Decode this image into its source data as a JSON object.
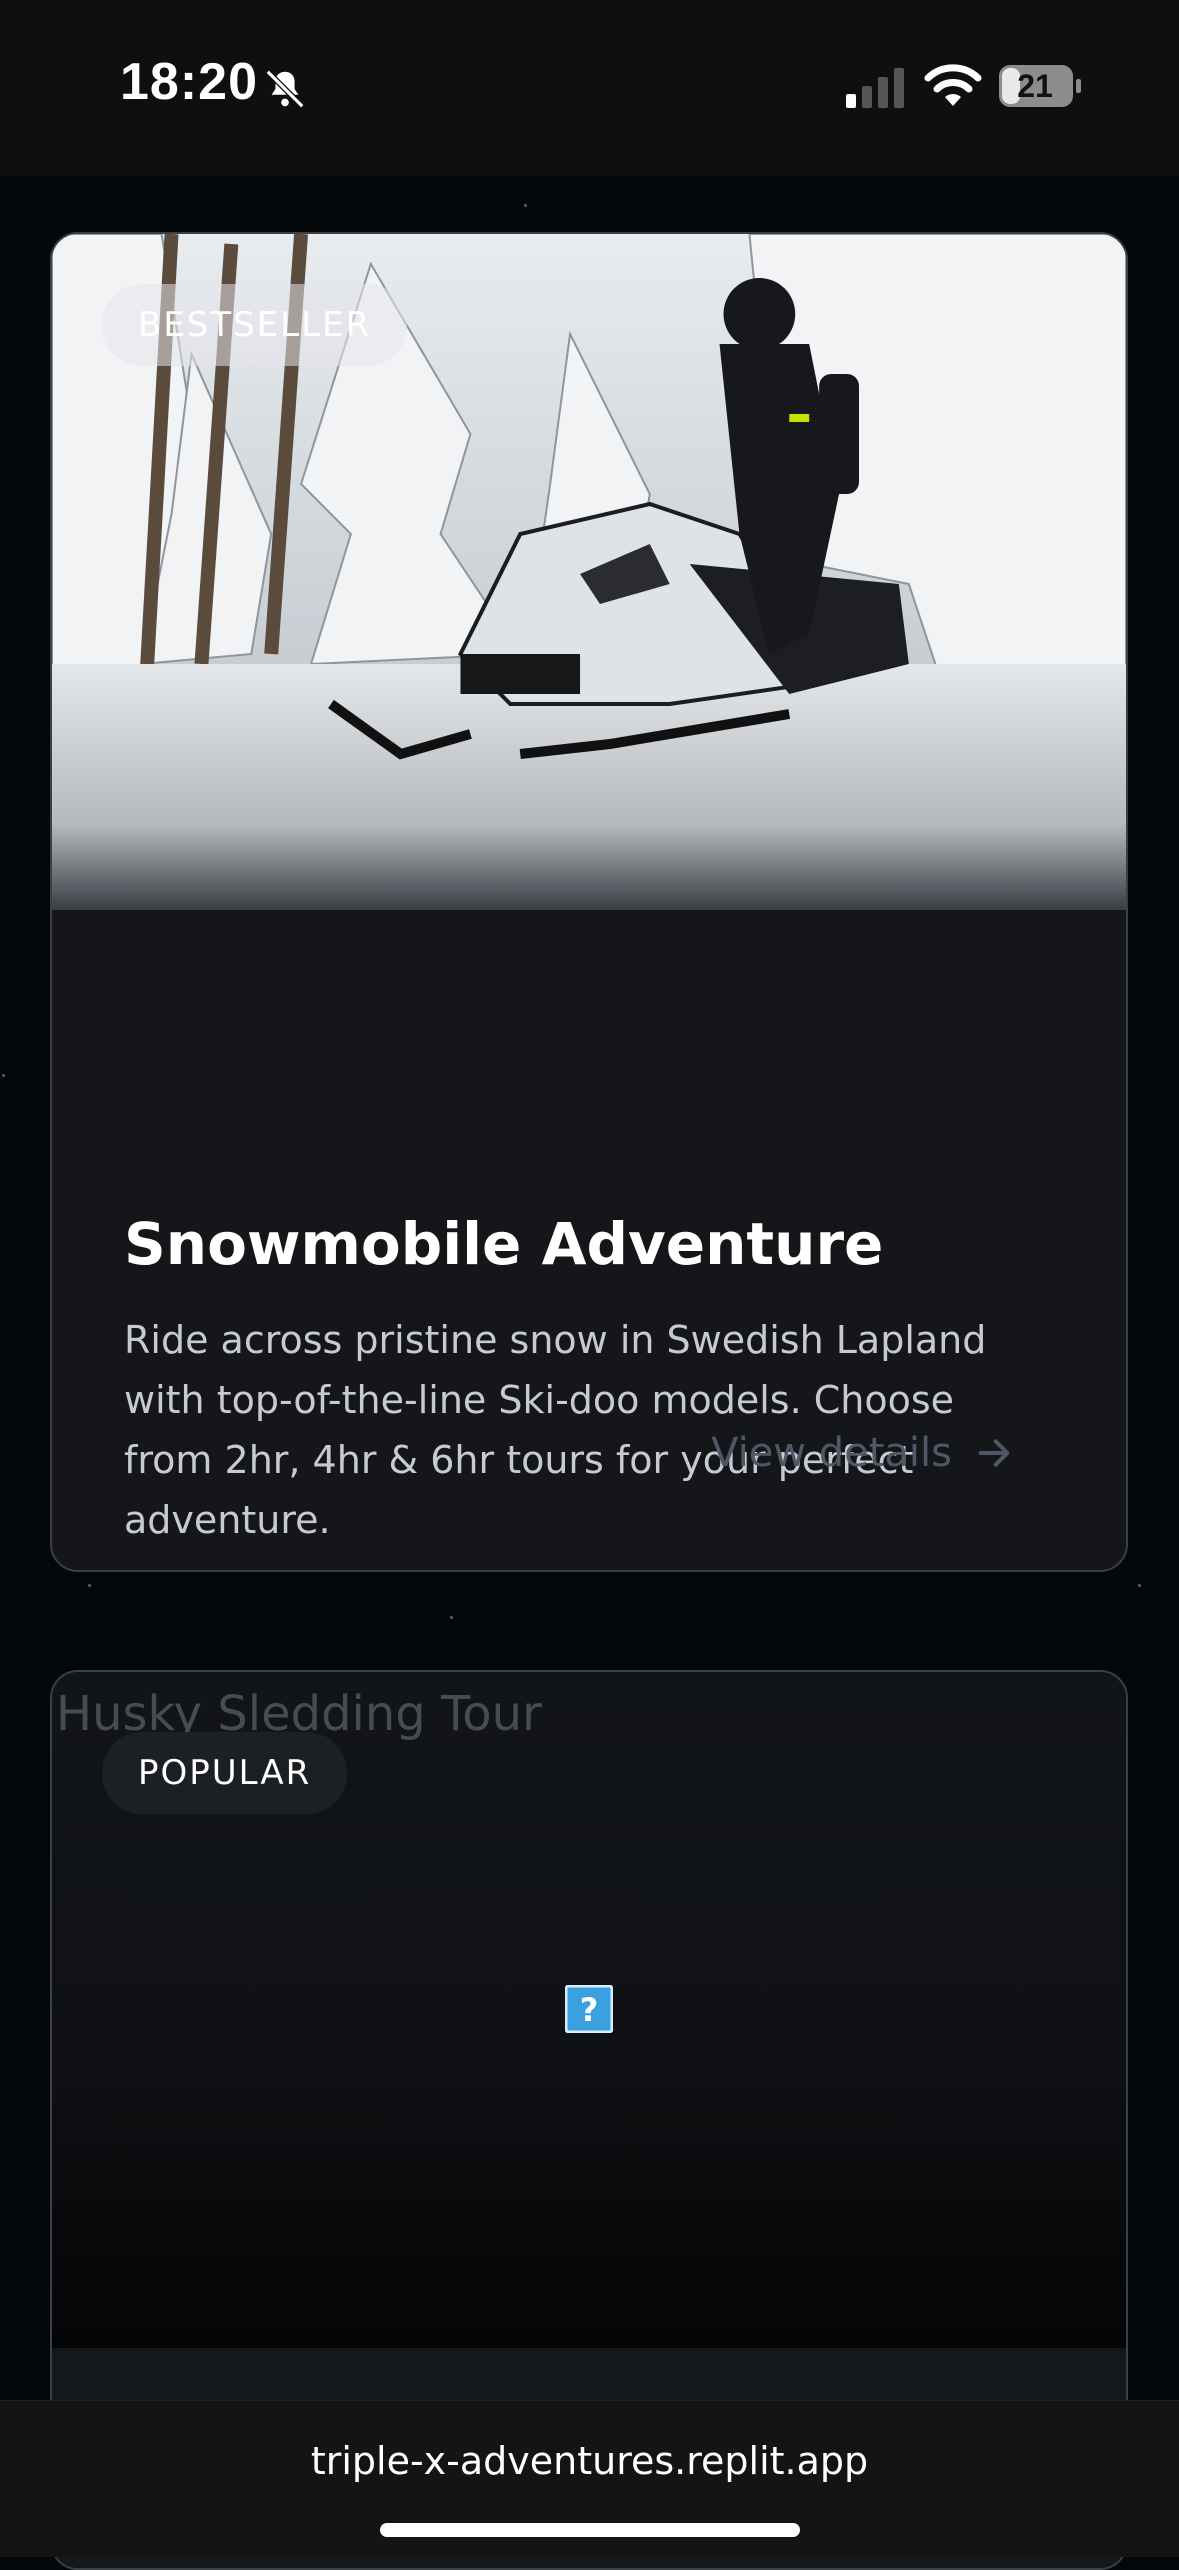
{
  "status_bar": {
    "time": "18:20",
    "battery": "21",
    "icons": [
      "bell-slash-icon",
      "cellular-signal-icon",
      "wifi-icon",
      "battery-icon"
    ]
  },
  "cards": [
    {
      "badge": "BESTSELLER",
      "title": "Snowmobile Adventure",
      "description": "Ride across pristine snow in Swedish Lapland with top-of-the-line Ski-doo models. Choose from 2hr, 4hr & 6hr tours for your perfect adventure.",
      "link": "View details"
    },
    {
      "badge": "POPULAR",
      "image_alt": "Husky Sledding Tour"
    }
  ],
  "browser": {
    "url": "triple-x-adventures.replit.app"
  },
  "colors": {
    "background": "#05080b",
    "card": "#141619",
    "muted_link": "#4f5866"
  }
}
